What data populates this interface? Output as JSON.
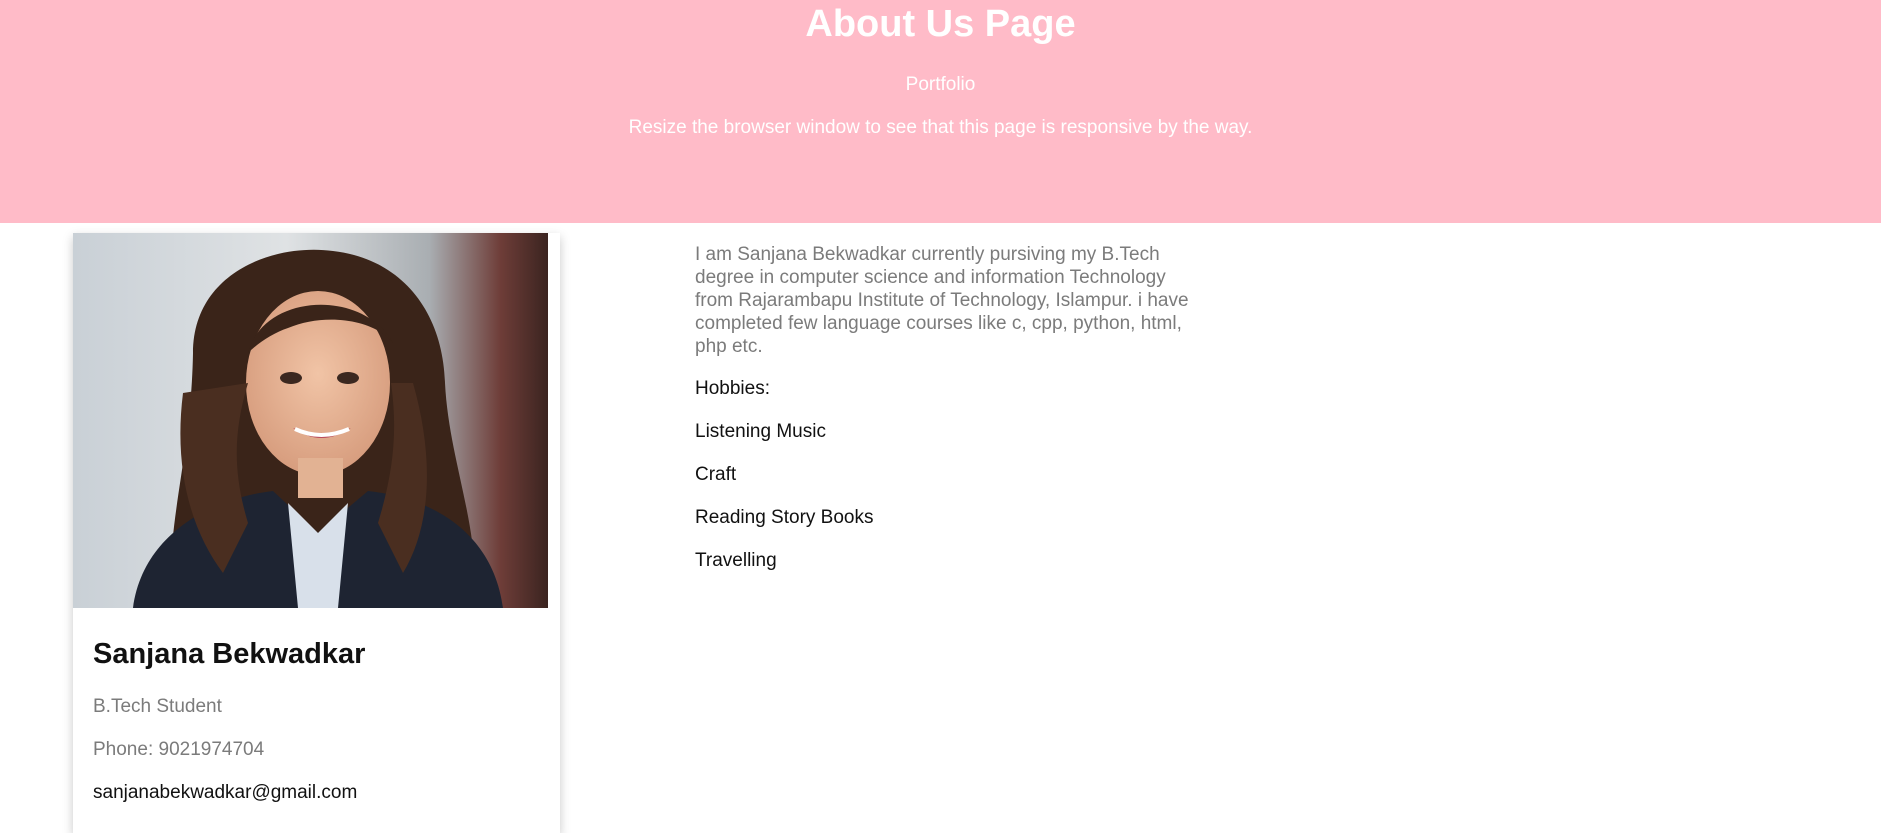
{
  "header": {
    "title": "About Us Page",
    "subtitle": "Portfolio",
    "note": "Resize the browser window to see that this page is responsive by the way.",
    "background_color": "#ffbbc8"
  },
  "profile": {
    "photo_icon": "person-photo",
    "name": "Sanjana Bekwadkar",
    "role": "B.Tech Student",
    "phone": "Phone: 9021974704",
    "email": "sanjanabekwadkar@gmail.com"
  },
  "about": {
    "bio": "I am Sanjana Bekwadkar currently pursiving my B.Tech degree in computer science and information Technology from Rajarambapu Institute of Technology, Islampur. i have completed few language courses like c, cpp, python, html, php etc.",
    "hobbies_label": "Hobbies:",
    "hobbies": [
      "Listening Music",
      "Craft",
      "Reading Story Books",
      "Travelling"
    ]
  }
}
